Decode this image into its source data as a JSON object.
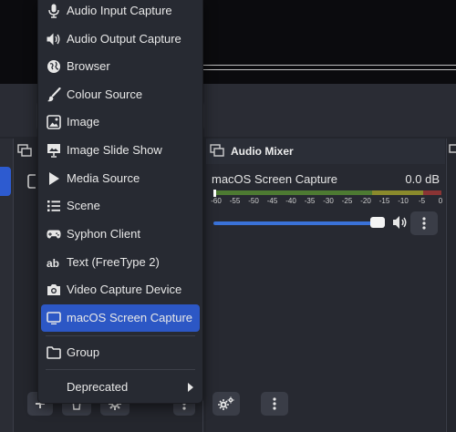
{
  "menu": {
    "items": [
      {
        "label": "Audio Input Capture",
        "icon": "microphone-icon"
      },
      {
        "label": "Audio Output Capture",
        "icon": "speaker-icon"
      },
      {
        "label": "Browser",
        "icon": "globe-icon"
      },
      {
        "label": "Colour Source",
        "icon": "paintbrush-icon"
      },
      {
        "label": "Image",
        "icon": "image-icon"
      },
      {
        "label": "Image Slide Show",
        "icon": "slideshow-icon"
      },
      {
        "label": "Media Source",
        "icon": "play-icon"
      },
      {
        "label": "Scene",
        "icon": "list-icon"
      },
      {
        "label": "Syphon Client",
        "icon": "gamepad-icon"
      },
      {
        "label": "Text (FreeType 2)",
        "icon": "text-ab-icon"
      },
      {
        "label": "Video Capture Device",
        "icon": "camera-icon"
      },
      {
        "label": "macOS Screen Capture",
        "icon": "monitor-icon",
        "selected": true
      }
    ],
    "group_label": "Group",
    "deprecated_label": "Deprecated"
  },
  "mixer": {
    "title": "Audio Mixer",
    "source_name": "macOS Screen Capture",
    "level": "0.0 dB",
    "ticks": [
      "-60",
      "-55",
      "-50",
      "-45",
      "-40",
      "-35",
      "-30",
      "-25",
      "-20",
      "-15",
      "-10",
      "-5",
      "0"
    ],
    "volume_fraction": 1.0
  },
  "colors": {
    "accent": "#2c57c5",
    "slider": "#3a72d8",
    "meter_green": "#4d7a32",
    "meter_yellow": "#8a8a2c",
    "meter_red": "#8a3434"
  }
}
